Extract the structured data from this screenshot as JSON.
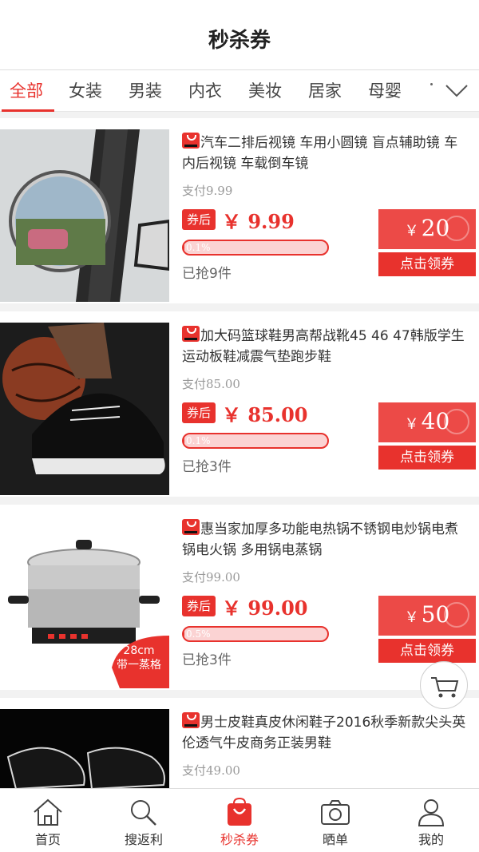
{
  "header": {
    "title": "秒杀券"
  },
  "tabs": [
    {
      "label": "全部",
      "active": true
    },
    {
      "label": "女装"
    },
    {
      "label": "男装"
    },
    {
      "label": "内衣"
    },
    {
      "label": "美妆"
    },
    {
      "label": "居家"
    },
    {
      "label": "母婴"
    }
  ],
  "icons": {
    "tabs_toggle": "chevron-down-icon",
    "platform_badge": "tmall-icon",
    "cart": "cart-icon"
  },
  "colors": {
    "accent": "#e8322d",
    "coupon": "#ec4a47",
    "progress_track": "#fbd3d3"
  },
  "products": [
    {
      "title": "汽车二排后视镜 车用小圆镜 盲点辅助镜 车内后视镜 车载倒车镜",
      "pay": "支付9.99",
      "after_tag": "券后",
      "price": "￥ 9.99",
      "progress_text": "0.1%",
      "progress": 0.001,
      "sold": "已抢9件",
      "coupon_currency": "￥",
      "coupon_amount": "20",
      "claim": "点击领券"
    },
    {
      "title": "加大码篮球鞋男高帮战靴45 46 47韩版学生运动板鞋减震气垫跑步鞋",
      "pay": "支付85.00",
      "after_tag": "券后",
      "price": "￥ 85.00",
      "progress_text": "0.1%",
      "progress": 0.001,
      "sold": "已抢3件",
      "coupon_currency": "￥",
      "coupon_amount": "40",
      "claim": "点击领券"
    },
    {
      "title": "惠当家加厚多功能电热锅不锈钢电炒锅电煮锅电火锅 多用锅电蒸锅",
      "pay": "支付99.00",
      "after_tag": "券后",
      "price": "￥ 99.00",
      "progress_text": "0.5%",
      "progress": 0.005,
      "sold": "已抢3件",
      "coupon_currency": "￥",
      "coupon_amount": "50",
      "claim": "点击领券",
      "image_badge": [
        "28cm",
        "带一蒸格"
      ]
    },
    {
      "title": "男士皮鞋真皮休闲鞋子2016秋季新款尖头英伦透气牛皮商务正装男鞋",
      "pay": "支付49.00"
    }
  ],
  "tabbar": [
    {
      "label": "首页",
      "icon": "home-icon"
    },
    {
      "label": "搜返利",
      "icon": "search-icon"
    },
    {
      "label": "秒杀券",
      "icon": "shopping-bag-icon",
      "active": true
    },
    {
      "label": "晒单",
      "icon": "camera-icon"
    },
    {
      "label": "我的",
      "icon": "user-icon"
    }
  ]
}
